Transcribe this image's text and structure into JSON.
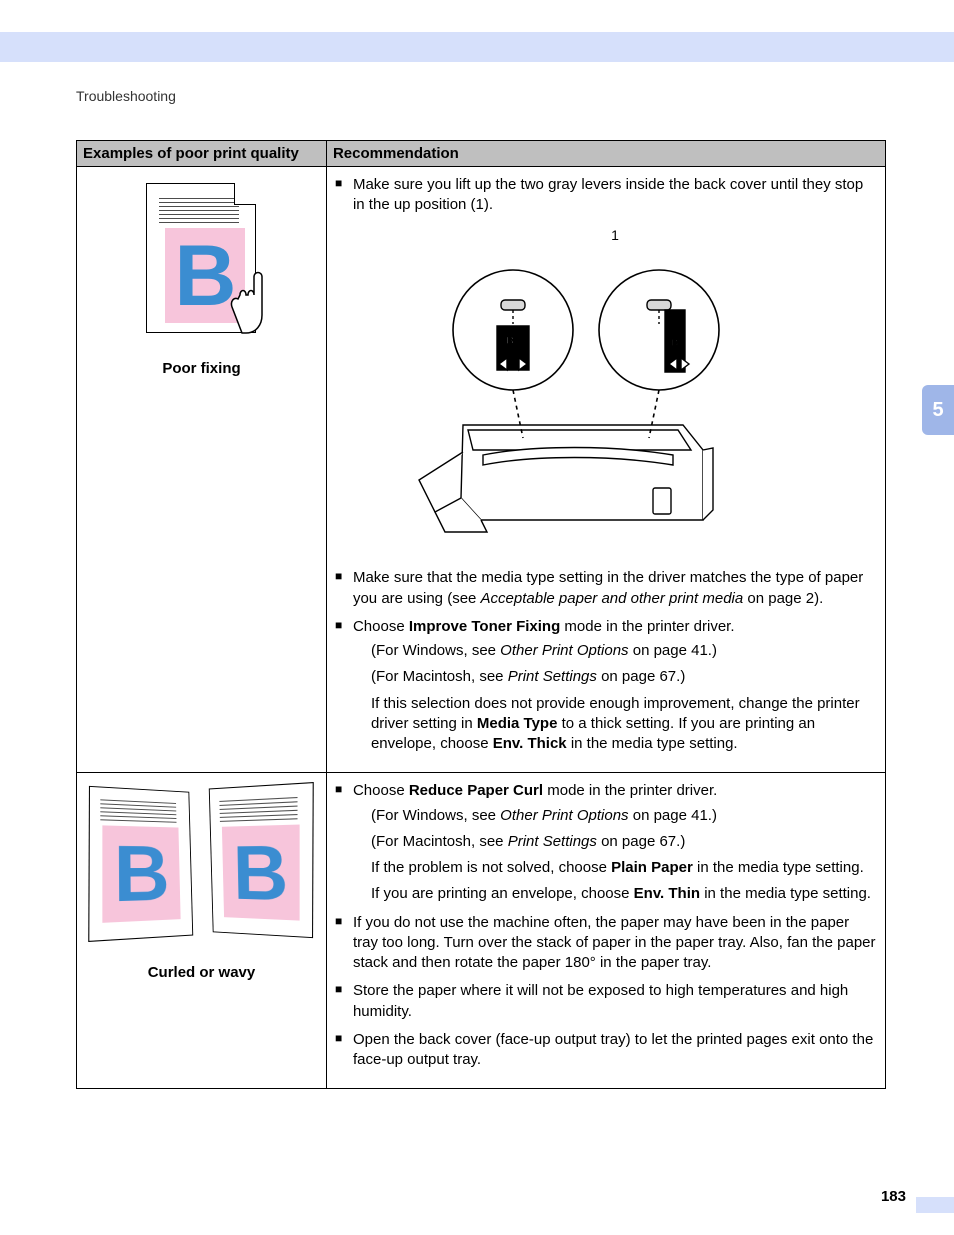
{
  "breadcrumb": "Troubleshooting",
  "chapter_tab": "5",
  "page_number": "183",
  "table": {
    "headers": {
      "col1": "Examples of poor print quality",
      "col2": "Recommendation"
    },
    "rows": [
      {
        "example_caption": "Poor fixing",
        "callout_number": "1",
        "recs": {
          "b1": "Make sure you lift up the two gray levers inside the back cover until they stop in the up position (1).",
          "b2_pre": "Make sure that the media type setting in the driver matches the type of paper you are using (see ",
          "b2_link": "Acceptable paper and other print media",
          "b2_post": " on page 2).",
          "b3_pre": "Choose ",
          "b3_bold": "Improve Toner Fixing",
          "b3_post": " mode in the printer driver.",
          "win_pre": "(For Windows, see ",
          "win_link": "Other Print Options",
          "win_post": " on page 41.)",
          "mac_pre": "(For Macintosh, see ",
          "mac_link": "Print Settings",
          "mac_post": " on page 67.)",
          "note_pre": "If this selection does not provide enough improvement, change the printer driver setting in ",
          "note_b1": "Media Type",
          "note_mid": " to a thick setting. If you are printing an envelope, choose ",
          "note_b2": "Env. Thick",
          "note_post": " in the media type setting."
        }
      },
      {
        "example_caption": "Curled or wavy",
        "recs": {
          "b1_pre": "Choose ",
          "b1_bold": "Reduce Paper Curl",
          "b1_post": " mode in the printer driver.",
          "win_pre": "(For Windows, see ",
          "win_link": "Other Print Options",
          "win_post": " on page 41.)",
          "mac_pre": "(For Macintosh, see ",
          "mac_link": "Print Settings",
          "mac_post": " on page 67.)",
          "note1_pre": "If the problem is not solved, choose ",
          "note1_bold": "Plain Paper",
          "note1_post": " in the media type setting.",
          "note2_pre": "If you are printing an envelope, choose ",
          "note2_bold": "Env. Thin",
          "note2_post": " in the media type setting.",
          "b2": "If you do not use the machine often, the paper may have been in the paper tray too long. Turn over the stack of paper in the paper tray. Also, fan the paper stack and then rotate the paper 180° in the paper tray.",
          "b3": "Store the paper where it will not be exposed to high temperatures and high humidity.",
          "b4": "Open the back cover (face-up output tray) to let the printed pages exit onto the face-up output tray."
        }
      }
    ]
  }
}
